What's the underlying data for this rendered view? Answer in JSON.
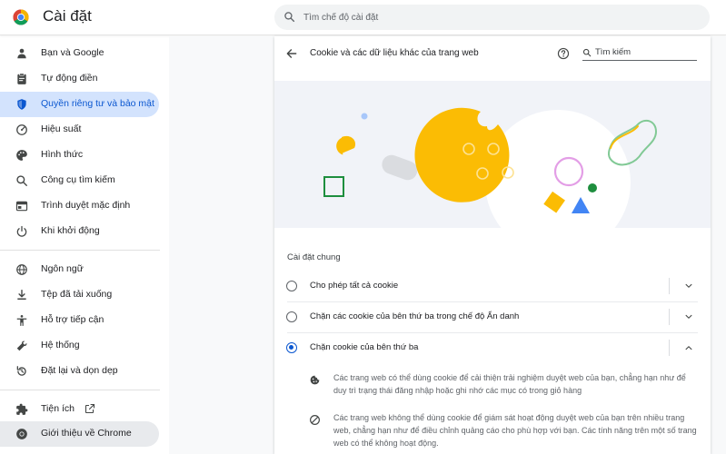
{
  "app": {
    "title": "Cài đặt"
  },
  "search": {
    "placeholder": "Tìm chế độ cài đặt"
  },
  "sidebar": {
    "items": [
      {
        "label": "Bạn và Google",
        "icon": "person-icon"
      },
      {
        "label": "Tự động điền",
        "icon": "clipboard-icon"
      },
      {
        "label": "Quyền riêng tư và bảo mật",
        "icon": "shield-icon",
        "active": true
      },
      {
        "label": "Hiệu suất",
        "icon": "speedometer-icon"
      },
      {
        "label": "Hình thức",
        "icon": "palette-icon"
      },
      {
        "label": "Công cụ tìm kiếm",
        "icon": "search-icon"
      },
      {
        "label": "Trình duyệt mặc định",
        "icon": "browser-icon"
      },
      {
        "label": "Khi khởi động",
        "icon": "power-icon"
      },
      {
        "label": "Ngôn ngữ",
        "icon": "globe-icon"
      },
      {
        "label": "Tệp đã tải xuống",
        "icon": "download-icon"
      },
      {
        "label": "Hỗ trợ tiếp cận",
        "icon": "accessibility-icon"
      },
      {
        "label": "Hệ thống",
        "icon": "wrench-icon"
      },
      {
        "label": "Đặt lại và dọn dẹp",
        "icon": "reset-icon"
      },
      {
        "label": "Tiện ích",
        "icon": "puzzle-icon"
      },
      {
        "label": "Giới thiệu về Chrome",
        "icon": "chrome-icon"
      }
    ]
  },
  "card": {
    "title": "Cookie và các dữ liệu khác của trang web",
    "search_placeholder": "Tìm kiếm",
    "section_title": "Cài đặt chung",
    "options": [
      {
        "label": "Cho phép tất cả cookie",
        "checked": false,
        "expanded": false
      },
      {
        "label": "Chặn các cookie của bên thứ ba trong chế độ Ẩn danh",
        "checked": false,
        "expanded": false
      },
      {
        "label": "Chặn cookie của bên thứ ba",
        "checked": true,
        "expanded": true
      }
    ],
    "details": [
      {
        "icon": "cookie-icon",
        "text": "Các trang web có thể dùng cookie để cải thiện trải nghiệm duyệt web của bạn, chẳng hạn như để duy trì trạng thái đăng nhập hoặc ghi nhớ các mục có trong giỏ hàng"
      },
      {
        "icon": "block-icon",
        "text": "Các trang web không thể dùng cookie để giám sát hoạt động duyệt web của bạn trên nhiều trang web, chẳng hạn như để điều chỉnh quảng cáo cho phù hợp với bạn. Các tính năng trên một số trang web có thể không hoạt động."
      }
    ]
  },
  "colors": {
    "accent": "#0b57d0",
    "active_bg": "#d3e3fd",
    "cookie_yellow": "#fbbc04",
    "illustration_green": "#1e8e3e",
    "illustration_blue": "#4285f4",
    "illustration_pink": "#e39ee6"
  }
}
